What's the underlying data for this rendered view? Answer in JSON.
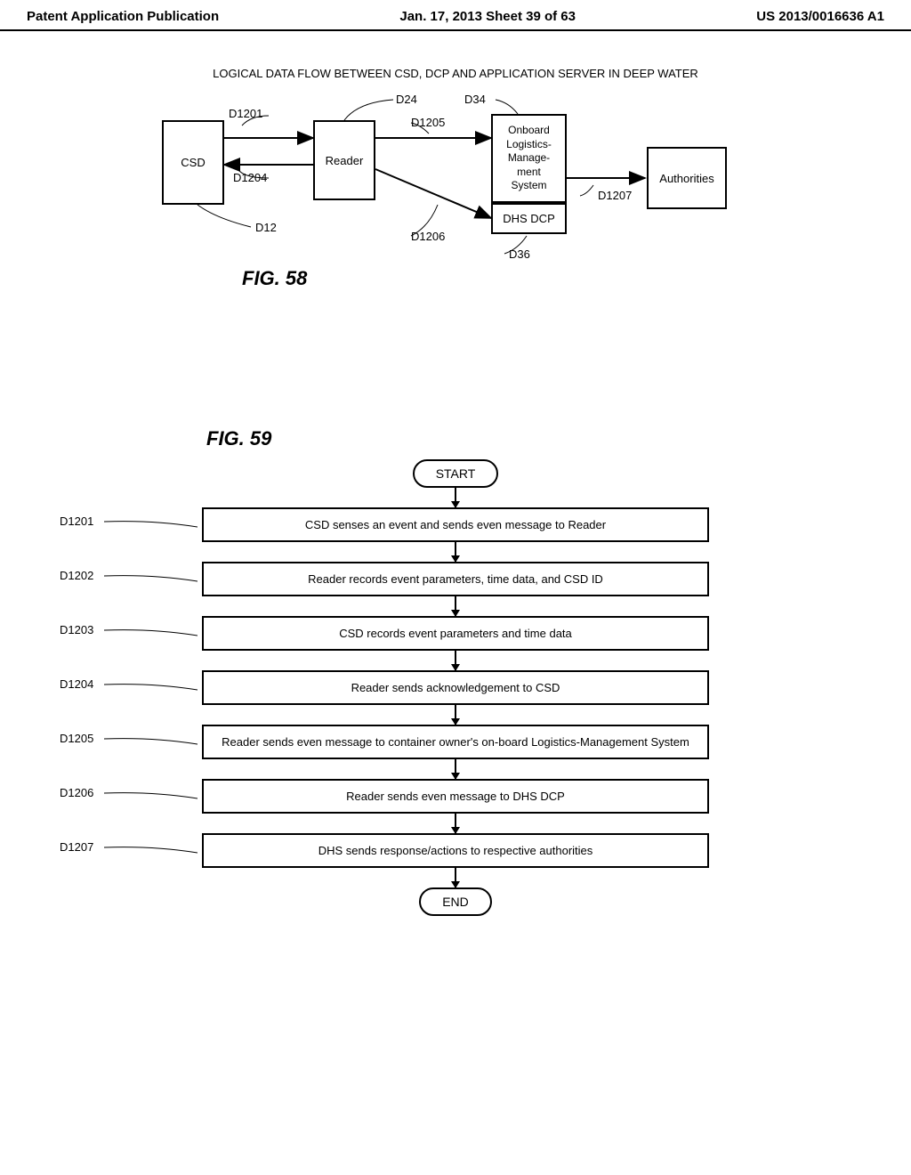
{
  "header": {
    "left": "Patent Application Publication",
    "center": "Jan. 17, 2013  Sheet 39 of 63",
    "right": "US 2013/0016636 A1"
  },
  "fig58": {
    "title": "LOGICAL DATA FLOW BETWEEN CSD, DCP AND APPLICATION SERVER IN DEEP WATER",
    "boxes": {
      "csd": "CSD",
      "reader": "Reader",
      "olms_l1": "Onboard",
      "olms_l2": "Logistics-",
      "olms_l3": "Manage-",
      "olms_l4": "ment",
      "olms_l5": "System",
      "dhsdcp": "DHS DCP",
      "authorities": "Authorities"
    },
    "labels": {
      "d1201": "D1201",
      "d1204": "D1204",
      "d12": "D12",
      "d24": "D24",
      "d1205": "D1205",
      "d1206": "D1206",
      "d34": "D34",
      "d36": "D36",
      "d1207": "D1207"
    },
    "figlabel": "FIG. 58"
  },
  "fig59": {
    "figlabel": "FIG. 59",
    "start": "START",
    "end": "END",
    "steps": [
      {
        "id": "D1201",
        "text": "CSD senses an event and sends even message to Reader"
      },
      {
        "id": "D1202",
        "text": "Reader records event parameters, time data, and CSD ID"
      },
      {
        "id": "D1203",
        "text": "CSD records event parameters and time data"
      },
      {
        "id": "D1204",
        "text": "Reader sends acknowledgement to CSD"
      },
      {
        "id": "D1205",
        "text": "Reader sends even message to container owner's on-board Logistics-Management System"
      },
      {
        "id": "D1206",
        "text": "Reader sends even message to DHS DCP"
      },
      {
        "id": "D1207",
        "text": "DHS sends response/actions to respective authorities"
      }
    ]
  }
}
